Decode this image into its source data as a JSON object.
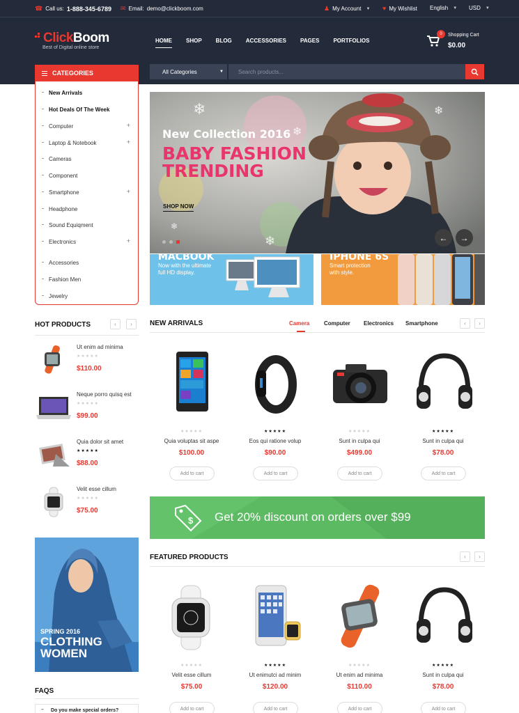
{
  "topbar": {
    "call_label": "Call us:",
    "phone": "1-888-345-6789",
    "email_label": "Email:",
    "email": "demo@clickboom.com",
    "account": "My Account",
    "wishlist": "My Wishlist",
    "language": "English",
    "currency": "USD"
  },
  "brand": {
    "name_part1": "Click",
    "name_part2": "Boom",
    "tagline": "Best of Digital online store",
    "accent_color": "#e8382f",
    "header_color": "#232a3a"
  },
  "nav": [
    "HOME",
    "SHOP",
    "BLOG",
    "ACCESSORIES",
    "PAGES",
    "PORTFOLIOS"
  ],
  "cart": {
    "label": "Shopping Cart",
    "amount": "$0.00",
    "count": "0"
  },
  "search": {
    "category": "All Categories",
    "placeholder": "Search products..."
  },
  "categories": {
    "title": "CATEGORIES",
    "items": [
      {
        "label": "New Arrivals",
        "bold": true,
        "expand": false
      },
      {
        "label": "Hot Deals Of The Week",
        "bold": true,
        "expand": false
      },
      {
        "label": "Computer",
        "bold": false,
        "expand": true
      },
      {
        "label": "Laptop & Notebook",
        "bold": false,
        "expand": true
      },
      {
        "label": "Cameras",
        "bold": false,
        "expand": false
      },
      {
        "label": "Component",
        "bold": false,
        "expand": false
      },
      {
        "label": "Smartphone",
        "bold": false,
        "expand": true
      },
      {
        "label": "Headphone",
        "bold": false,
        "expand": false
      },
      {
        "label": "Sound Equiqment",
        "bold": false,
        "expand": false
      },
      {
        "label": "Electronics",
        "bold": false,
        "expand": true
      },
      {
        "label": "Accessories",
        "bold": false,
        "expand": false
      },
      {
        "label": "Fashion Men",
        "bold": false,
        "expand": false
      },
      {
        "label": "Jewelry",
        "bold": false,
        "expand": false
      }
    ]
  },
  "slider": {
    "line1": "New Collection 2016",
    "line2": "BABY FASHION",
    "line3": "TRENDING",
    "cta": "SHOP NOW"
  },
  "banners": [
    {
      "title": "MACBOOK",
      "subtitle": "Now with the ultimate\nfull HD display."
    },
    {
      "title": "IPHONE 6S",
      "subtitle": "Smart protection\nwith style."
    }
  ],
  "hot_products": {
    "title": "HOT PRODUCTS",
    "items": [
      {
        "name": "Ut enim ad minima",
        "price": "$110.00",
        "rating": 0
      },
      {
        "name": "Neque porro quisq est",
        "price": "$99.00",
        "rating": 0
      },
      {
        "name": "Quia dolor sit amet",
        "price": "$88.00",
        "rating": 5
      },
      {
        "name": "Velit esse cillum",
        "price": "$75.00",
        "rating": 0
      }
    ]
  },
  "new_arrivals": {
    "title": "NEW ARRIVALS",
    "tabs": [
      "Camera",
      "Computer",
      "Electronics",
      "Smartphone"
    ],
    "active_tab": "Camera",
    "items": [
      {
        "name": "Quia voluptas sit aspe",
        "price": "$100.00",
        "rating": 0,
        "image": "smartphone"
      },
      {
        "name": "Eos qui ratione volup",
        "price": "$90.00",
        "rating": 5,
        "image": "fitness-band"
      },
      {
        "name": "Sunt in culpa qui",
        "price": "$499.00",
        "rating": 0,
        "image": "camera"
      },
      {
        "name": "Sunt in culpa qui",
        "price": "$78.00",
        "rating": 5,
        "image": "headphones"
      }
    ]
  },
  "add_to_cart_label": "Add to cart",
  "promo": {
    "text": "Get 20% discount on orders over $99"
  },
  "featured": {
    "title": "FEATURED PRODUCTS",
    "items": [
      {
        "name": "Velit esse cillum",
        "price": "$75.00",
        "rating": 0,
        "image": "smartwatch-white"
      },
      {
        "name": "Ut enimutci ad minim",
        "price": "$120.00",
        "rating": 5,
        "image": "iphone-watch"
      },
      {
        "name": "Ut enim ad minima",
        "price": "$110.00",
        "rating": 0,
        "image": "smartwatch-orange"
      },
      {
        "name": "Sunt in culpa qui",
        "price": "$78.00",
        "rating": 5,
        "image": "headphones"
      }
    ]
  },
  "ad": {
    "line1": "SPRING 2016",
    "line2": "CLOTHING",
    "line3": "WOMEN"
  },
  "faqs": {
    "title": "FAQS",
    "first_question": "Do you make special orders?"
  }
}
